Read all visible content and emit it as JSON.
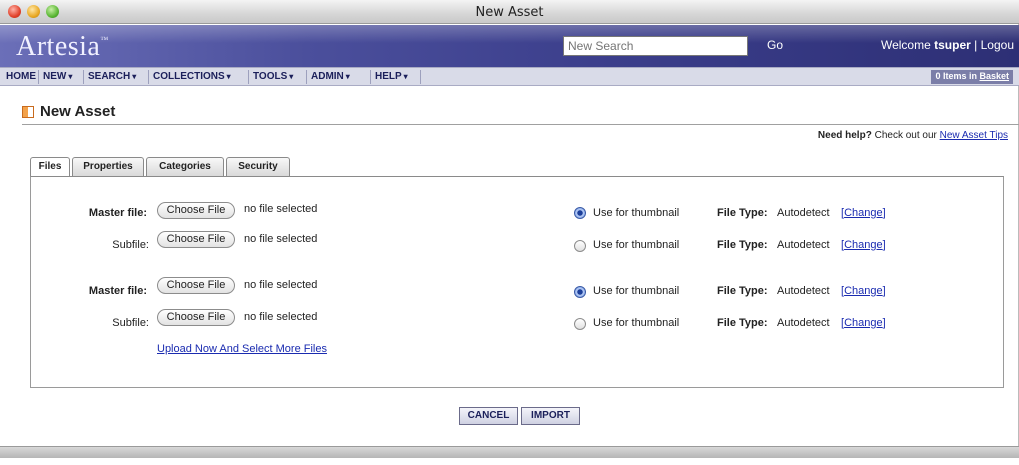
{
  "window": {
    "title": "New Asset"
  },
  "brand": {
    "logo_text": "Artesia",
    "logo_mark": "™",
    "search_placeholder": "New Search",
    "go_label": "Go",
    "welcome_prefix": "Welcome",
    "username": "tsuper",
    "separator": "|",
    "logout_label": "Logou"
  },
  "nav": {
    "items": [
      {
        "label": "HOME",
        "caret": ""
      },
      {
        "label": "NEW",
        "caret": "▾"
      },
      {
        "label": "SEARCH",
        "caret": "▾"
      },
      {
        "label": "COLLECTIONS",
        "caret": "▾"
      },
      {
        "label": "TOOLS",
        "caret": "▾"
      },
      {
        "label": "ADMIN",
        "caret": "▾"
      },
      {
        "label": "HELP",
        "caret": "▾"
      }
    ],
    "basket_count": "0 Items in",
    "basket_link": "Basket"
  },
  "page": {
    "title": "New Asset",
    "help_prefix": "Need help?",
    "help_text": "Check out our",
    "help_link": "New Asset Tips"
  },
  "tabs": [
    {
      "label": "Files",
      "active": true
    },
    {
      "label": "Properties",
      "active": false
    },
    {
      "label": "Categories",
      "active": false
    },
    {
      "label": "Security",
      "active": false
    }
  ],
  "file_rows": [
    {
      "label": "Master file:",
      "bold": true,
      "button": "Choose File",
      "status": "no file selected",
      "radio_label": "Use for thumbnail",
      "checked": true,
      "type_label": "File Type:",
      "type_value": "Autodetect",
      "change": "Change"
    },
    {
      "label": "Subfile:",
      "bold": false,
      "button": "Choose File",
      "status": "no file selected",
      "radio_label": "Use for thumbnail",
      "checked": false,
      "type_label": "File Type:",
      "type_value": "Autodetect",
      "change": "Change"
    },
    {
      "label": "Master file:",
      "bold": true,
      "button": "Choose File",
      "status": "no file selected",
      "radio_label": "Use for thumbnail",
      "checked": true,
      "type_label": "File Type:",
      "type_value": "Autodetect",
      "change": "Change"
    },
    {
      "label": "Subfile:",
      "bold": false,
      "button": "Choose File",
      "status": "no file selected",
      "radio_label": "Use for thumbnail",
      "checked": false,
      "type_label": "File Type:",
      "type_value": "Autodetect",
      "change": "Change"
    }
  ],
  "upload_link": "Upload Now And Select More Files",
  "actions": {
    "cancel": "CANCEL",
    "import": "IMPORT"
  },
  "colors": {
    "brand_bar": "#3b3e8b",
    "nav_bg": "#d9dbe8",
    "link": "#1a2bb0"
  }
}
